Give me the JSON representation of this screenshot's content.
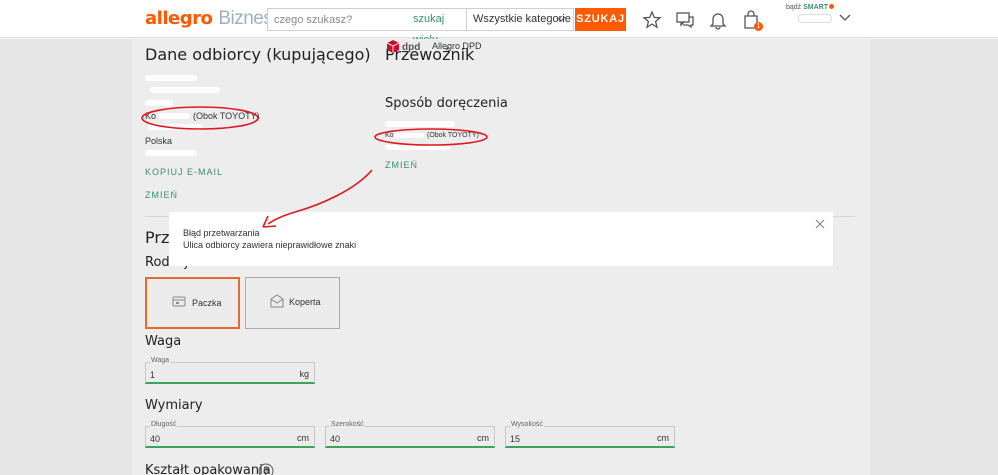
{
  "header": {
    "logo_brand": "allegro",
    "logo_suffix": "Biznes",
    "search_placeholder": "czego szukasz?",
    "search_many": "szukaj wielu",
    "category": "Wszystkie kategorie",
    "search_button": "SZUKAJ",
    "cart_count": "1",
    "smart_prefix": "bądź",
    "smart_label": "SMART"
  },
  "recipient": {
    "title": "Dane odbiorcy (kupującego)",
    "street_suffix": "(Obok TOYOTY)",
    "street_prefix": "Ko",
    "country": "Polska",
    "copy_email": "KOPIUJ E-MAIL",
    "change": "ZMIEŃ"
  },
  "carrier": {
    "title": "Przewoźnik",
    "carrier_name": "Allegro DPD",
    "delivery_title": "Sposób doręczenia",
    "address_prefix": "Ko",
    "address_suffix": "(Obok TOYOTY)",
    "change": "ZMIEŃ"
  },
  "package": {
    "section_title": "Prze",
    "type_label": "Rodzaj",
    "type_options": [
      "Paczka",
      "Koperta"
    ],
    "weight_title": "Waga",
    "weight_label": "Waga",
    "weight_value": "1",
    "weight_unit": "kg",
    "dims_title": "Wymiary",
    "length_label": "Długość",
    "length_value": "40",
    "width_label": "Szerokość",
    "width_value": "40",
    "height_label": "Wysokość",
    "height_value": "15",
    "dim_unit": "cm",
    "shape_title": "Kształt opakowania"
  },
  "modal": {
    "title": "Błąd przetwarzania",
    "message": "Ulica odbiorcy zawiera nieprawidłowe znaki"
  },
  "colors": {
    "accent": "#ff5a00",
    "link": "#3a8f6e",
    "annotation": "#e0181f"
  }
}
